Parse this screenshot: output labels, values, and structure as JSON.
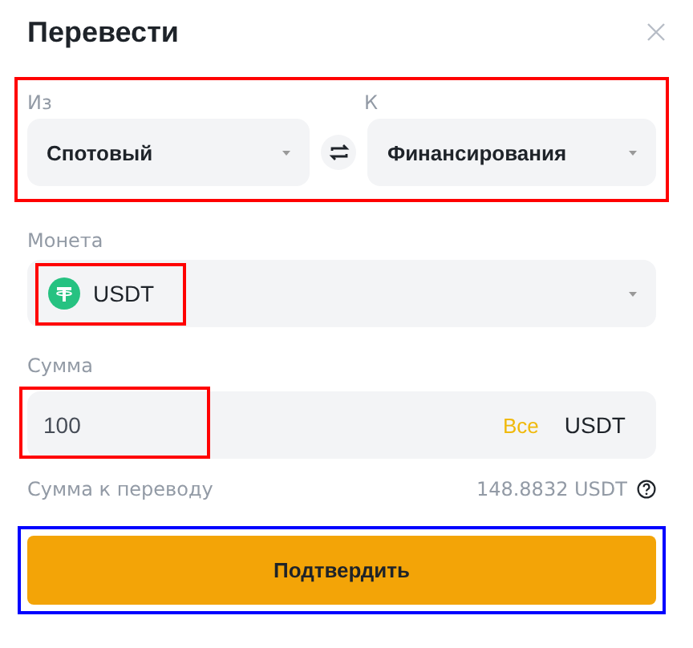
{
  "title": "Перевести",
  "transfer": {
    "color": "#ff0000",
    "from": {
      "label": "Из",
      "value": "Спотовый"
    },
    "to": {
      "label": "К",
      "value": "Финансирования"
    }
  },
  "coin": {
    "label": "Монета",
    "value": "USDT",
    "color": "#ff0000"
  },
  "amount": {
    "label": "Сумма",
    "value": "100",
    "max_link": "Все",
    "unit": "USDT",
    "color": "#ff0000"
  },
  "summary": {
    "label": "Сумма к переводу",
    "value": "148.8832 USDT"
  },
  "confirm_button": {
    "label": "Подтвердить",
    "color": "#0000ff"
  }
}
